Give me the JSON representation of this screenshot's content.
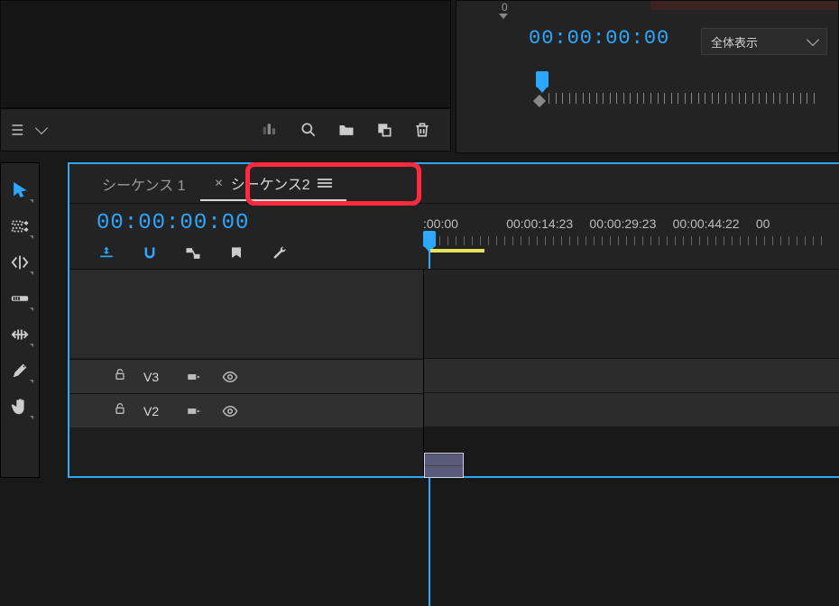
{
  "program": {
    "timecode": "00:00:00:00",
    "zoom_label": "全体表示"
  },
  "ruler_small_markers": [
    "0"
  ],
  "project_footer": {
    "icons": [
      "list-view",
      "search",
      "folder",
      "new-item",
      "trash"
    ]
  },
  "timeline": {
    "tabs": [
      {
        "label": "シーケンス 1",
        "active": false
      },
      {
        "label": "シーケンス2",
        "active": true
      }
    ],
    "timecode": "00:00:00:00",
    "time_marks": [
      ":00:00",
      "00:00:14:23",
      "00:00:29:23",
      "00:00:44:22",
      "00"
    ],
    "tracks": [
      {
        "label": "V3"
      },
      {
        "label": "V2"
      }
    ]
  }
}
